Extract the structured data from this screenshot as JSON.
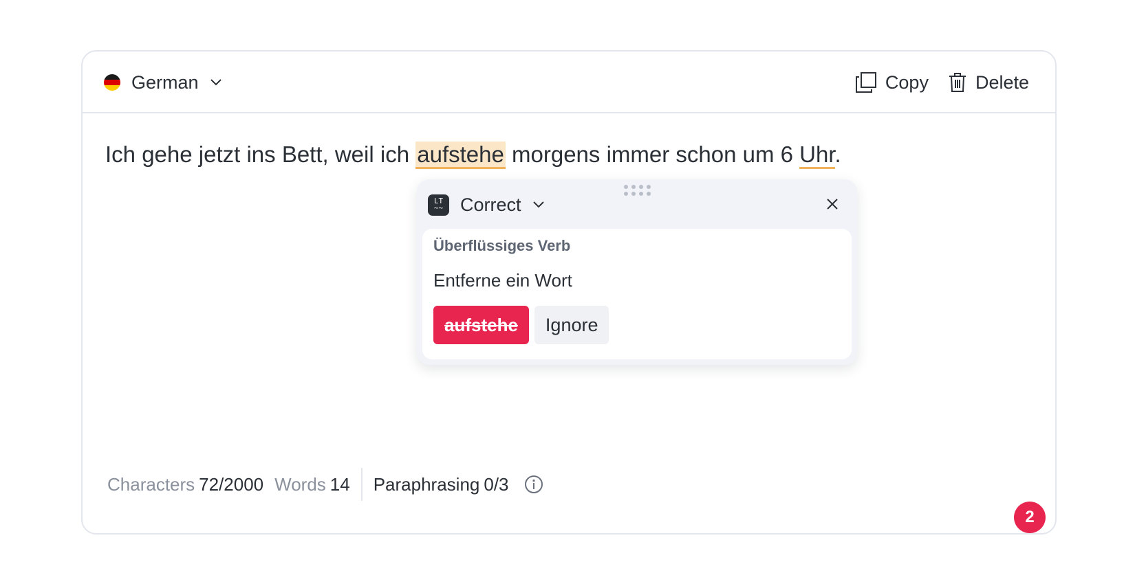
{
  "header": {
    "language": "German",
    "copy_label": "Copy",
    "delete_label": "Delete"
  },
  "text": {
    "before": "Ich gehe jetzt ins Bett, weil ich ",
    "error_word": "aufstehe",
    "middle": " morgens immer schon um 6 ",
    "minor_error_word": "Uhr",
    "after": "."
  },
  "popup": {
    "mode": "Correct",
    "logo": "LT",
    "rule_title": "Überflüssiges Verb",
    "message": "Entferne ein Wort",
    "suggestion": "aufstehe",
    "ignore_label": "Ignore"
  },
  "footer": {
    "characters_label": "Characters",
    "characters_value": "72/2000",
    "words_label": "Words",
    "words_value": "14",
    "paraphrasing_label": "Paraphrasing",
    "paraphrasing_value": "0/3",
    "issue_count": "2"
  },
  "colors": {
    "accent_red": "#e8254f",
    "highlight": "#fbe6c8",
    "underline": "#f0b25a"
  },
  "icons": [
    "german-flag-icon",
    "chevron-down-icon",
    "copy-icon",
    "trash-icon",
    "languagetool-logo-icon",
    "close-icon",
    "drag-handle-icon",
    "info-icon"
  ]
}
